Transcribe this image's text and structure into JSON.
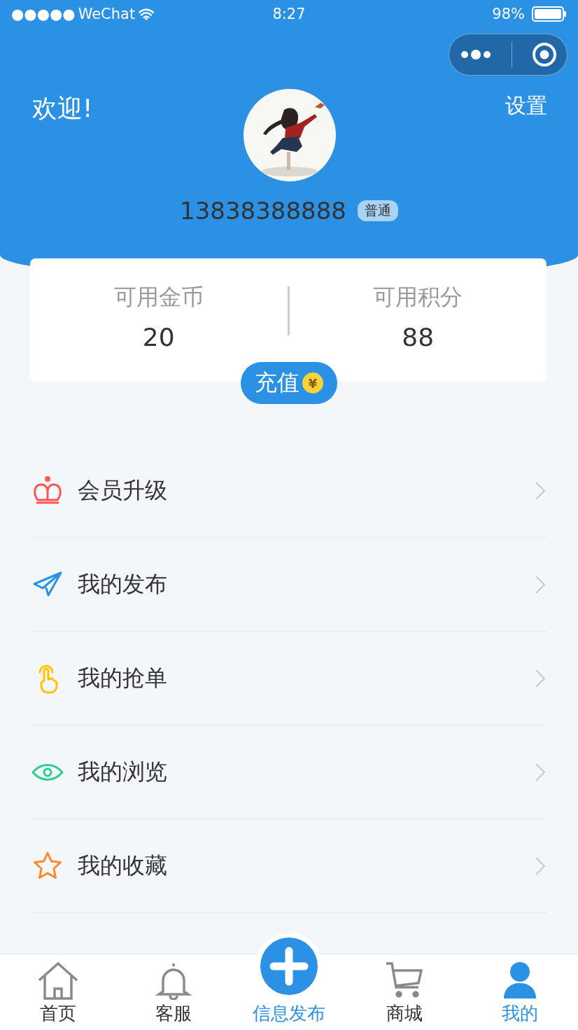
{
  "status_bar": {
    "signal": "●●●●●",
    "carrier": "WeChat",
    "time": "8:27",
    "battery": "98%"
  },
  "header": {
    "welcome": "欢迎!",
    "settings": "设置",
    "phone": "13838388888",
    "level_badge": "普通"
  },
  "balance_card": {
    "stats": [
      {
        "label": "可用金币",
        "value": "20"
      },
      {
        "label": "可用积分",
        "value": "88"
      }
    ],
    "recharge_button": "充值",
    "coin_symbol": "¥"
  },
  "menu": [
    {
      "kind": "crown",
      "label": "会员升级",
      "color": "#ff5555"
    },
    {
      "kind": "send",
      "label": "我的发布",
      "color": "#2a91e4"
    },
    {
      "kind": "tap",
      "label": "我的抢单",
      "color": "#ffc300"
    },
    {
      "kind": "eye",
      "label": "我的浏览",
      "color": "#2ecc8f"
    },
    {
      "kind": "star",
      "label": "我的收藏",
      "color": "#ff8a2a"
    }
  ],
  "tab_bar": [
    {
      "kind": "home",
      "label": "首页",
      "selected": false
    },
    {
      "kind": "bell",
      "label": "客服",
      "selected": false
    },
    {
      "kind": "publish",
      "label": "信息发布",
      "selected": false
    },
    {
      "kind": "cart",
      "label": "商城",
      "selected": false
    },
    {
      "kind": "user",
      "label": "我的",
      "selected": true
    }
  ]
}
